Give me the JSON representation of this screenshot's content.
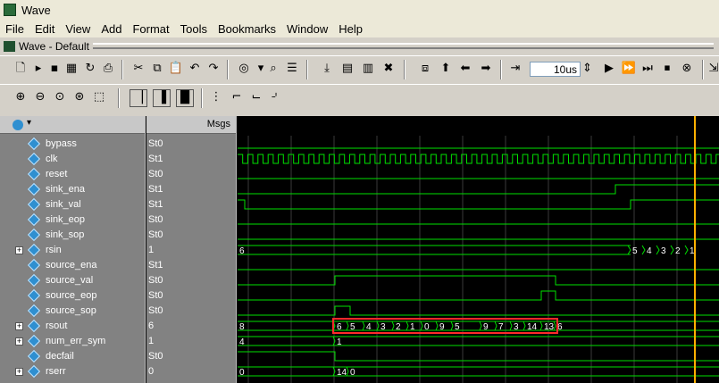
{
  "window": {
    "title": "Wave"
  },
  "menu": [
    "File",
    "Edit",
    "View",
    "Add",
    "Format",
    "Tools",
    "Bookmarks",
    "Window",
    "Help"
  ],
  "subwindow": {
    "title": "Wave - Default"
  },
  "toolbar": {
    "time_value": "10us"
  },
  "panel": {
    "msgs_label": "Msgs"
  },
  "signals": [
    {
      "name": "bypass",
      "value": "St0",
      "expandable": false
    },
    {
      "name": "clk",
      "value": "St1",
      "expandable": false
    },
    {
      "name": "reset",
      "value": "St0",
      "expandable": false
    },
    {
      "name": "sink_ena",
      "value": "St1",
      "expandable": false
    },
    {
      "name": "sink_val",
      "value": "St1",
      "expandable": false
    },
    {
      "name": "sink_eop",
      "value": "St0",
      "expandable": false
    },
    {
      "name": "sink_sop",
      "value": "St0",
      "expandable": false
    },
    {
      "name": "rsin",
      "value": "1",
      "expandable": true
    },
    {
      "name": "source_ena",
      "value": "St1",
      "expandable": false
    },
    {
      "name": "source_val",
      "value": "St0",
      "expandable": false
    },
    {
      "name": "source_eop",
      "value": "St0",
      "expandable": false
    },
    {
      "name": "source_sop",
      "value": "St0",
      "expandable": false
    },
    {
      "name": "rsout",
      "value": "6",
      "expandable": true
    },
    {
      "name": "num_err_sym",
      "value": "1",
      "expandable": true
    },
    {
      "name": "decfail",
      "value": "St0",
      "expandable": false
    },
    {
      "name": "rserr",
      "value": "0",
      "expandable": true
    }
  ],
  "waves": {
    "rsin_initial": "6",
    "rsin_tail": [
      "5",
      "4",
      "3",
      "2",
      "1"
    ],
    "rsout_initial": "8",
    "rsout_values": [
      "6",
      "5",
      "4",
      "3",
      "2",
      "1",
      "0",
      "9",
      "5",
      "9",
      "7",
      "3",
      "14",
      "13",
      "6"
    ],
    "num_err_sym_initial": "4",
    "num_err_sym_after": "1",
    "rserr_initial": "0",
    "rserr_values": [
      "14",
      "0"
    ]
  },
  "colors": {
    "wave": "#00e000",
    "cursor": "#ffb000",
    "highlight": "#ff2a2a",
    "grid": "#3a3a3a"
  }
}
